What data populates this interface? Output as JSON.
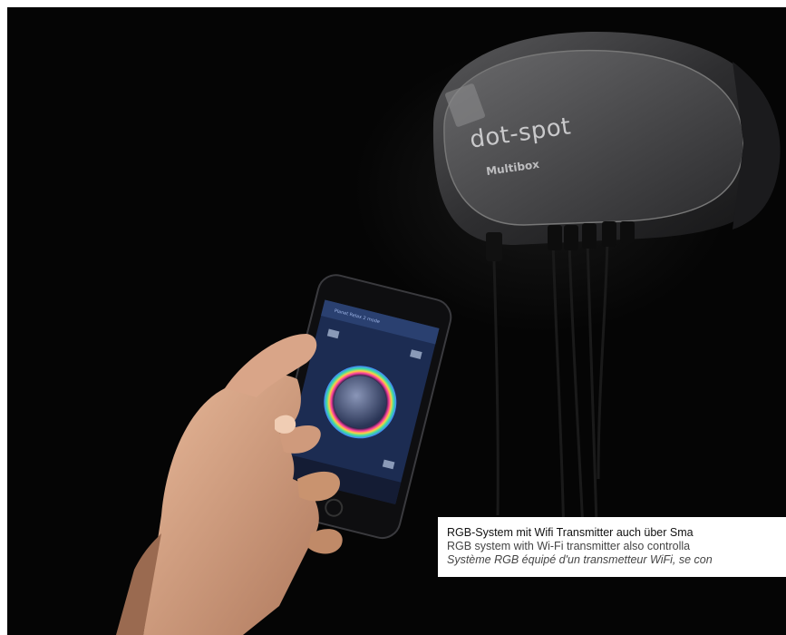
{
  "device": {
    "brand": "dot-spot",
    "model": "Multibox"
  },
  "caption": {
    "line_de": "RGB-System mit Wifi Transmitter auch über Sma",
    "line_en": "RGB system with Wi-Fi transmitter also controlla",
    "line_fr": "Système RGB équipé d'un transmetteur WiFi, se con"
  },
  "phone_app": {
    "header": "Planet Relax 2 mode"
  },
  "colors": {
    "background": "#050505",
    "device_body": "#2b2b2d",
    "phone_screen": "#1c2c52"
  }
}
